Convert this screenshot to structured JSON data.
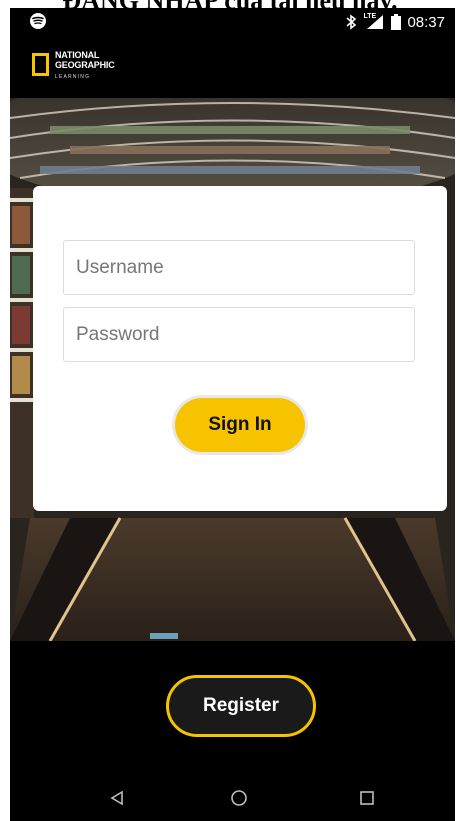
{
  "caption": "ĐĂNG NHẬP của tài liệu này.",
  "status_bar": {
    "time": "08:37",
    "network": "LTE",
    "icons": [
      "spotify-icon",
      "bluetooth-icon",
      "signal-icon",
      "battery-icon"
    ]
  },
  "header": {
    "brand_line1": "NATIONAL",
    "brand_line2": "GEOGRAPHIC",
    "brand_line3": "LEARNING"
  },
  "login": {
    "username_placeholder": "Username",
    "password_placeholder": "Password",
    "sign_in_label": "Sign In"
  },
  "register_label": "Register",
  "nav": {
    "icons": [
      "back-icon",
      "home-icon",
      "recents-icon"
    ]
  },
  "colors": {
    "accent": "#f7c300",
    "background": "#000000",
    "card": "#ffffff"
  }
}
